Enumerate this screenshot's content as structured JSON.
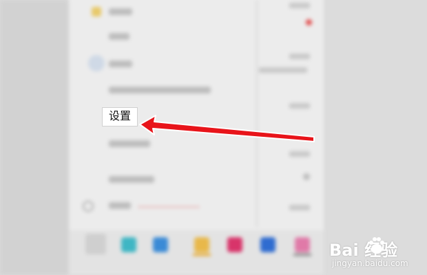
{
  "menu": {
    "settings_label": "设置"
  },
  "watermark": {
    "logo_text": "Bai 经验",
    "url": "jingyan.baidu.com"
  },
  "colors": {
    "arrow": "#e8141a",
    "highlight_bg": "#ffffff"
  },
  "icons": [
    "baidu-paw-icon"
  ]
}
